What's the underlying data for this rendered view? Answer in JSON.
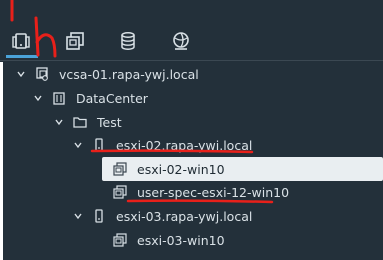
{
  "colors": {
    "background": "#23303a",
    "text": "#d9e1e6",
    "accent": "#4aa3d9",
    "selected_bg": "#e9eef1",
    "annotation": "#e8201a"
  },
  "toolbar": {
    "tabs": [
      {
        "icon": "hosts-clusters-icon",
        "active": true
      },
      {
        "icon": "vms-templates-icon"
      },
      {
        "icon": "storage-icon"
      },
      {
        "icon": "networking-icon"
      }
    ]
  },
  "tree": {
    "vcenter": "vcsa-01.rapa-ywj.local",
    "datacenter": "DataCenter",
    "folder": "Test",
    "host1": "esxi-02.rapa-ywj.local",
    "vm1": "esxi-02-win10",
    "vm2": "user-spec-esxi-12-win10",
    "host2": "esxi-03.rapa-ywj.local",
    "vm3": "esxi-03-win10"
  },
  "annotation": {
    "letter": "h"
  }
}
